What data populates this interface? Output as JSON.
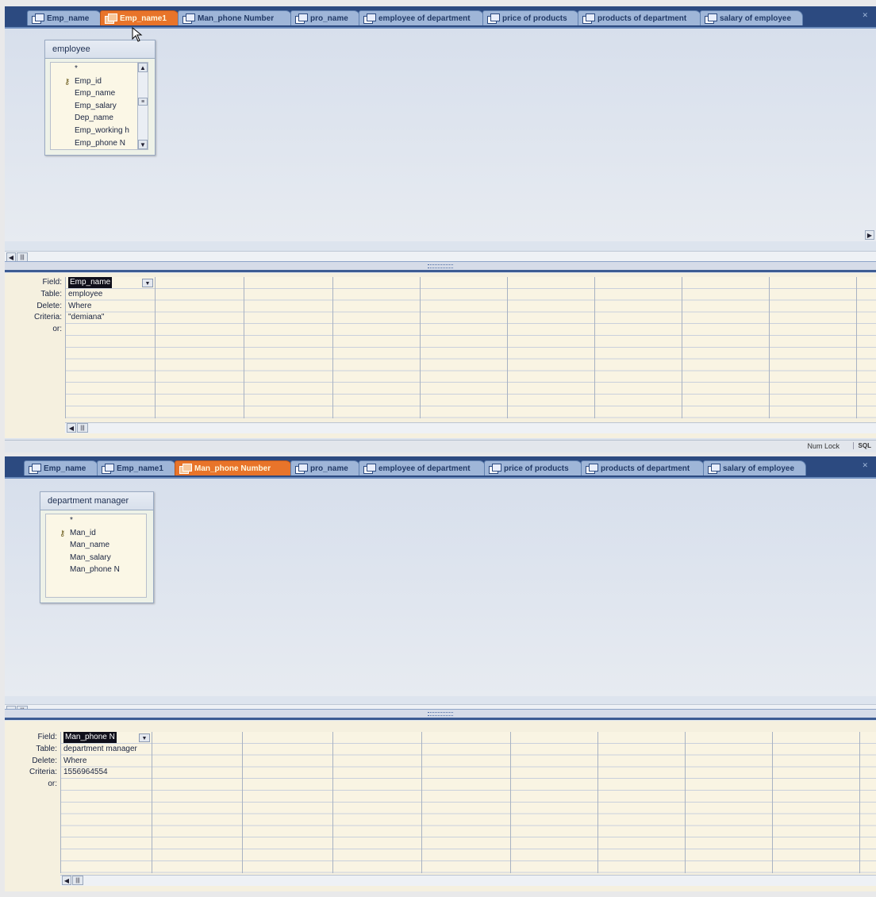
{
  "tabs": [
    "Emp_name",
    "Emp_name1",
    "Man_phone Number",
    "pro_name",
    "employee of department",
    "price of products",
    "products of department",
    "salary of employee"
  ],
  "grid_row_labels": [
    "Field:",
    "Table:",
    "Delete:",
    "Criteria:",
    "or:"
  ],
  "screen1": {
    "active_tab": "Emp_name1",
    "table": {
      "title": "employee",
      "fields": [
        "*",
        "Emp_id",
        "Emp_name",
        "Emp_salary",
        "Dep_name",
        "Emp_working h",
        "Emp_phone N"
      ]
    },
    "grid": {
      "field": "Emp_name",
      "table": "employee",
      "delete": "Where",
      "criteria": "\"demiana\"",
      "or": ""
    },
    "status": {
      "num_lock": "Num Lock",
      "sql": "SQL"
    }
  },
  "screen2": {
    "active_tab": "Man_phone Number",
    "table": {
      "title": "department manager",
      "fields": [
        "*",
        "Man_id",
        "Man_name",
        "Man_salary",
        "Man_phone N"
      ]
    },
    "grid": {
      "field": "Man_phone N",
      "table": "department manager",
      "delete": "Where",
      "criteria": "1556964554",
      "or": ""
    }
  }
}
